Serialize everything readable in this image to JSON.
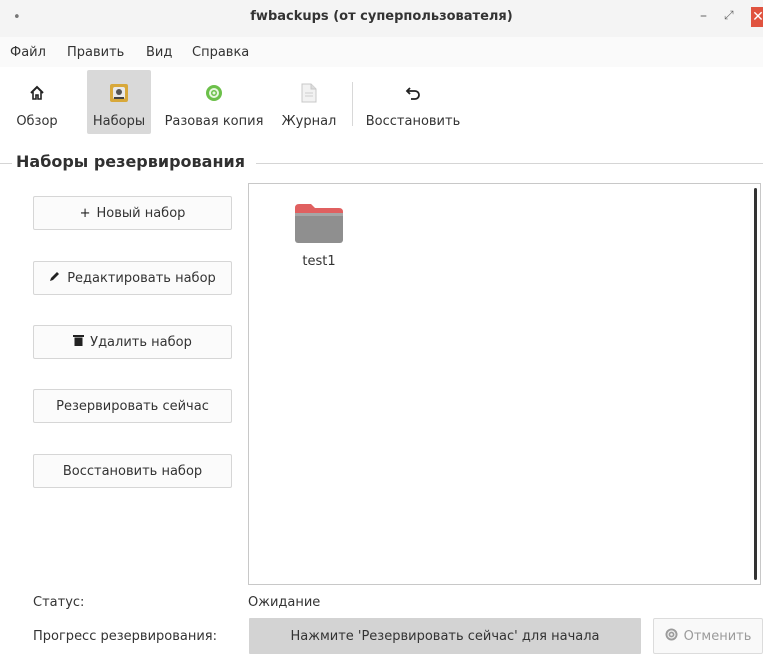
{
  "window": {
    "title": "fwbackups (от суперпользователя)",
    "controls": {
      "minimize": "–",
      "maximize": "⤢",
      "close": "✕"
    }
  },
  "menu": [
    "Файл",
    "Править",
    "Вид",
    "Справка"
  ],
  "toolbar": {
    "overview": "Обзор",
    "sets": "Наборы",
    "onetime": "Разовая копия",
    "log": "Журнал",
    "restore": "Восстановить",
    "active": "sets"
  },
  "section_title": "Наборы резервирования",
  "buttons": {
    "new_set": "Новый набор",
    "edit_set": "Редактировать набор",
    "delete_set": "Удалить набор",
    "backup_now": "Резервировать сейчас",
    "restore_set": "Восстановить набор"
  },
  "sets": [
    {
      "name": "test1",
      "icon": "folder-icon"
    }
  ],
  "status": {
    "label": "Статус:",
    "value": "Ожидание"
  },
  "progress": {
    "label": "Прогресс резервирования:",
    "text": "Нажмите 'Резервировать сейчас' для начала",
    "cancel": "Отменить"
  },
  "colors": {
    "close": "#e0533f",
    "folder_tab": "#e06060",
    "folder_body": "#8f8f8f",
    "active_tool": "#d9d9d9"
  }
}
